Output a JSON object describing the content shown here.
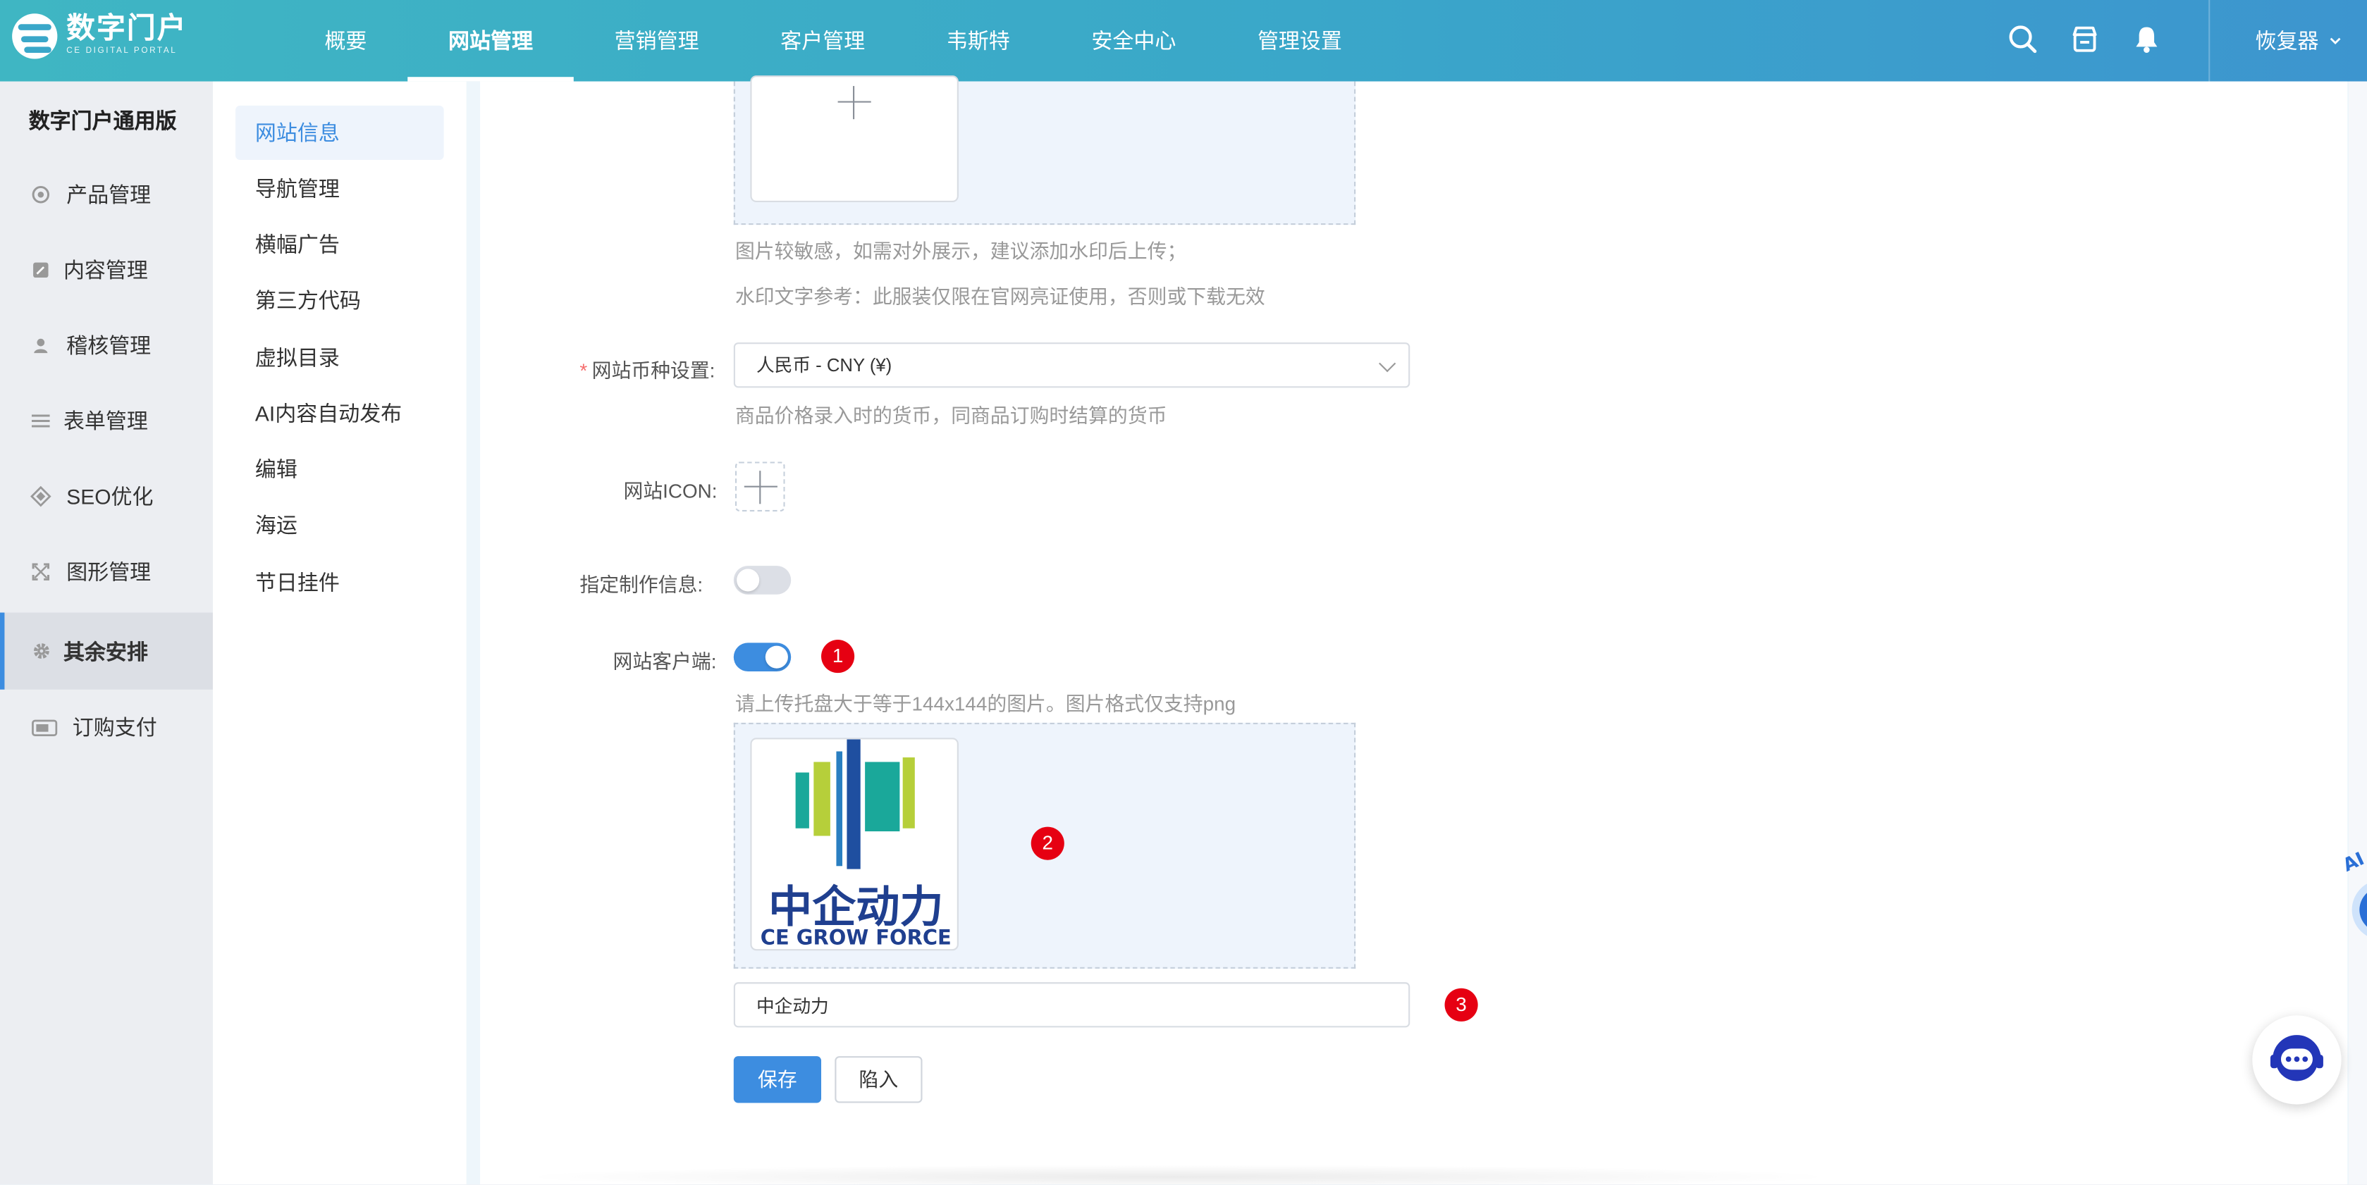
{
  "brand": {
    "title": "数字门户",
    "subtitle": "CE DIGITAL PORTAL"
  },
  "nav": [
    "概要",
    "网站管理",
    "营销管理",
    "客户管理",
    "韦斯特",
    "安全中心",
    "管理设置"
  ],
  "nav_active": "网站管理",
  "user": {
    "name": "恢复器"
  },
  "header_icons": [
    "search-icon",
    "store-icon",
    "bell-icon"
  ],
  "sidebar": {
    "title": "数字门户通用版",
    "items": [
      {
        "label": "产品管理",
        "icon": "product-icon"
      },
      {
        "label": "内容管理",
        "icon": "edit-icon"
      },
      {
        "label": "稽核管理",
        "icon": "user-icon"
      },
      {
        "label": "表单管理",
        "icon": "list-icon"
      },
      {
        "label": "SEO优化",
        "icon": "seo-icon"
      },
      {
        "label": "图形管理",
        "icon": "expand-icon"
      },
      {
        "label": "其余安排",
        "icon": "gear-icon"
      },
      {
        "label": "订购支付",
        "icon": "card-icon"
      }
    ],
    "active": "其余安排"
  },
  "subnav": {
    "items": [
      "网站信息",
      "导航管理",
      "横幅广告",
      "第三方代码",
      "虚拟目录",
      "AI内容自动发布",
      "编辑",
      "海运",
      "节日挂件"
    ],
    "active": "网站信息"
  },
  "form": {
    "image_hint_1": "图片较敏感，如需对外展示，建议添加水印后上传；",
    "image_hint_2": "水印文字参考：此服装仅限在官网亮证使用，否则或下载无效",
    "currency_label": "网站币种设置:",
    "currency_value": "人民币 - CNY (¥)",
    "currency_hint": "商品价格录入时的货币，同商品订购时结算的货币",
    "icon_label": "网站ICON:",
    "production_label": "指定制作信息:",
    "production_enabled": false,
    "client_label": "网站客户端:",
    "client_enabled": true,
    "client_hint": "请上传托盘大于等于144x144的图片。图片格式仅支持png",
    "client_logo": {
      "cn_text": "中企动力",
      "en_text": "CE GROW FORCE"
    },
    "client_name_value": "中企动力",
    "save_label": "保存",
    "cancel_label": "陷入"
  },
  "annotations": [
    "1",
    "2",
    "3"
  ],
  "colors": {
    "accent": "#3d8de0",
    "header_start": "#3fb6c3",
    "header_end": "#3d95cf",
    "badge": "#e60012"
  }
}
